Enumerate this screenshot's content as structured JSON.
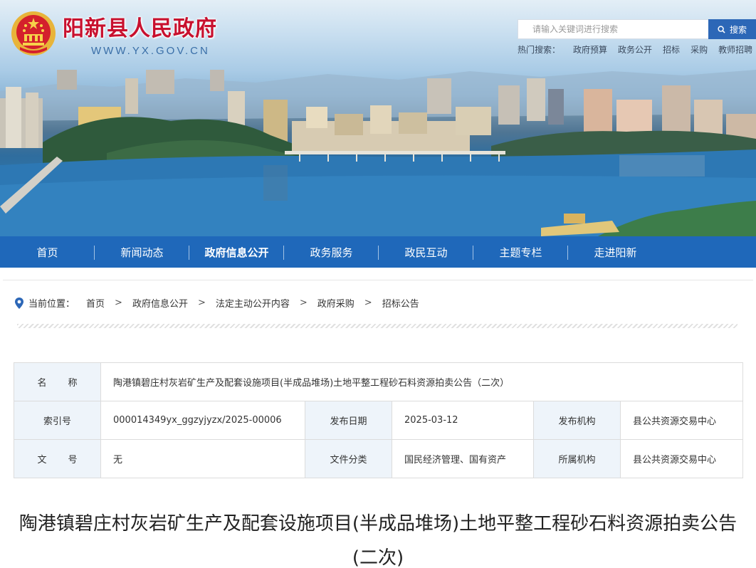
{
  "header": {
    "site_name": "阳新县人民政府",
    "site_url": "WWW.YX.GOV.CN",
    "search_placeholder": "请输入关键词进行搜索",
    "search_button": "搜索",
    "hot_label": "热门搜索：",
    "hot_links": [
      "政府预算",
      "政务公开",
      "招标",
      "采购",
      "教师招聘"
    ]
  },
  "nav": {
    "items": [
      "首页",
      "新闻动态",
      "政府信息公开",
      "政务服务",
      "政民互动",
      "主题专栏",
      "走进阳新"
    ],
    "active": "政府信息公开"
  },
  "breadcrumb": {
    "label": "当前位置：",
    "items": [
      "首页",
      "政府信息公开",
      "法定主动公开内容",
      "政府采购",
      "招标公告"
    ],
    "separator": ">"
  },
  "info": {
    "name_label": "名称",
    "name_value": "陶港镇碧庄村灰岩矿生产及配套设施项目(半成品堆场)土地平整工程砂石料资源拍卖公告（二次）",
    "index_label": "索引号",
    "index_value": "000014349yx_ggzyjyzx/2025-00006",
    "date_label": "发布日期",
    "date_value": "2025-03-12",
    "publisher_label": "发布机构",
    "publisher_value": "县公共资源交易中心",
    "docno_label": "文号",
    "docno_value": "无",
    "category_label": "文件分类",
    "category_value": "国民经济管理、国有资产",
    "owner_label": "所属机构",
    "owner_value": "县公共资源交易中心"
  },
  "article": {
    "title": "陶港镇碧庄村灰岩矿生产及配套设施项目(半成品堆场)土地平整工程砂石料资源拍卖公告(二次)"
  },
  "colors": {
    "nav_bg": "#1f68ba",
    "search_btn": "#2c67b7",
    "site_name": "#c8102e",
    "table_label_bg": "#eef4fa"
  }
}
